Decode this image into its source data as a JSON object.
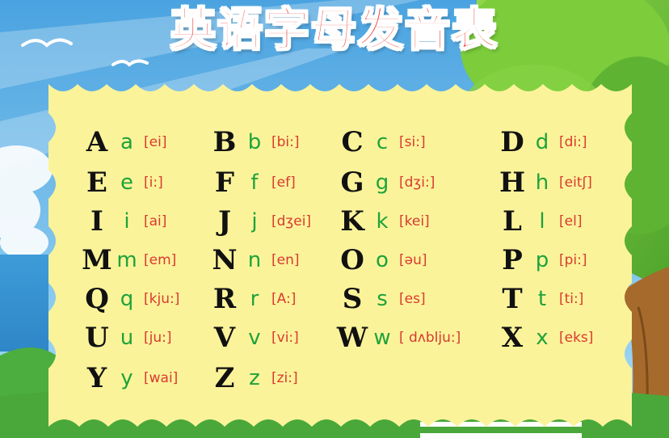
{
  "title": "英语字母发音表",
  "columns": [
    [
      {
        "upper": "A",
        "lower": "a",
        "ipa": "[ei]"
      },
      {
        "upper": "E",
        "lower": "e",
        "ipa": "[i:]"
      },
      {
        "upper": "I",
        "lower": "i",
        "ipa": "[ai]"
      },
      {
        "upper": "M",
        "lower": "m",
        "ipa": "[em]"
      },
      {
        "upper": "Q",
        "lower": "q",
        "ipa": "[kju:]"
      },
      {
        "upper": "U",
        "lower": "u",
        "ipa": "[ju:]"
      },
      {
        "upper": "Y",
        "lower": "y",
        "ipa": "[wai]"
      }
    ],
    [
      {
        "upper": "B",
        "lower": "b",
        "ipa": "[bi:]"
      },
      {
        "upper": "F",
        "lower": "f",
        "ipa": "[ef]"
      },
      {
        "upper": "J",
        "lower": "j",
        "ipa": "[dʒei]"
      },
      {
        "upper": "N",
        "lower": "n",
        "ipa": "[en]"
      },
      {
        "upper": "R",
        "lower": "r",
        "ipa": "[A:]"
      },
      {
        "upper": "V",
        "lower": "v",
        "ipa": "[vi:]"
      },
      {
        "upper": "Z",
        "lower": "z",
        "ipa": "[zi:]"
      }
    ],
    [
      {
        "upper": "C",
        "lower": "c",
        "ipa": "[si:]"
      },
      {
        "upper": "G",
        "lower": "g",
        "ipa": "[dʒi:]"
      },
      {
        "upper": "K",
        "lower": "k",
        "ipa": "[kei]"
      },
      {
        "upper": "O",
        "lower": "o",
        "ipa": "[əu]"
      },
      {
        "upper": "S",
        "lower": "s",
        "ipa": "[es]"
      },
      {
        "upper": "W",
        "lower": "w",
        "ipa": "[ dʌblju:]"
      }
    ],
    [
      {
        "upper": "D",
        "lower": "d",
        "ipa": "[di:]"
      },
      {
        "upper": "H",
        "lower": "h",
        "ipa": "[eitʃ]"
      },
      {
        "upper": "L",
        "lower": "l",
        "ipa": "[el]"
      },
      {
        "upper": "P",
        "lower": "p",
        "ipa": "[pi:]"
      },
      {
        "upper": "T",
        "lower": "t",
        "ipa": "[ti:]"
      },
      {
        "upper": "X",
        "lower": "x",
        "ipa": "[eks]"
      }
    ]
  ],
  "colors": {
    "sky": "#5bb3e8",
    "board": "#fbf39a",
    "uppercase": "#111111",
    "lowercase": "#1ea33a",
    "ipa": "#d93a30",
    "title": "#e8362c",
    "tree": "#6cc23a",
    "grass": "#4aa83a"
  }
}
